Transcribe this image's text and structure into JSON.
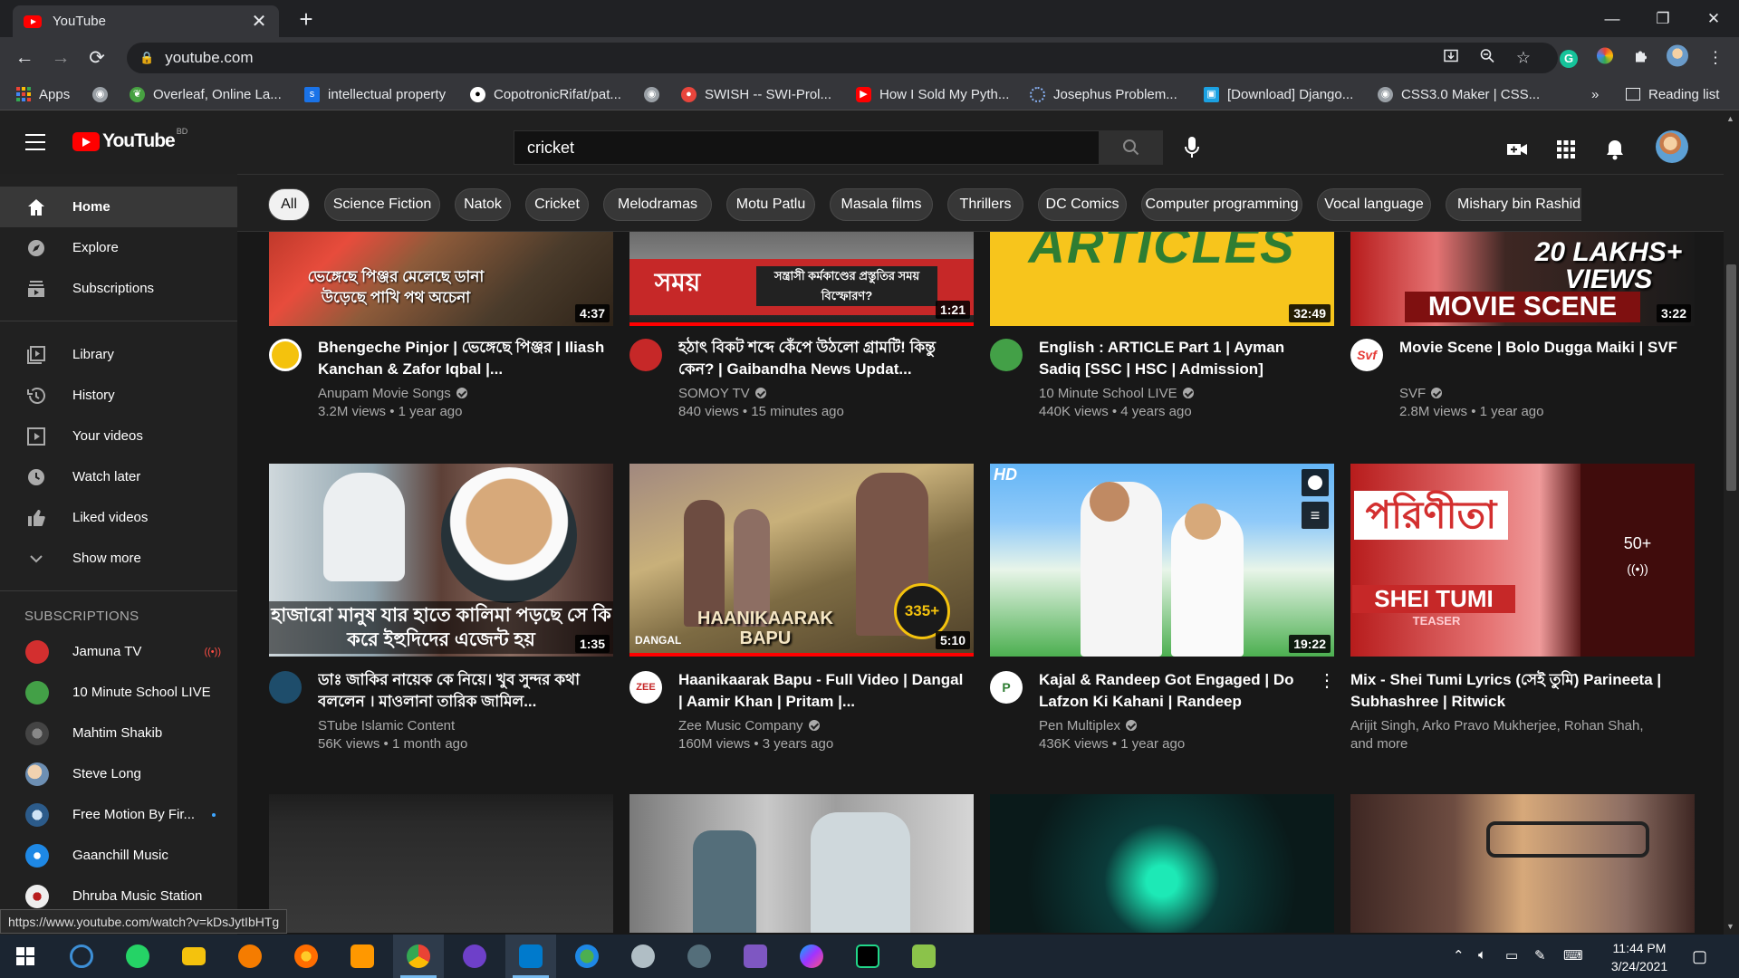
{
  "browser": {
    "tab_title": "YouTube",
    "tab_close": "✕",
    "new_tab": "+",
    "url": "youtube.com",
    "lock": "🔒",
    "min": "—",
    "max": "❐",
    "close": "✕",
    "back": "←",
    "forward": "→",
    "reload": "⟳",
    "more_bookmarks": "»",
    "reading_list": "Reading list"
  },
  "bookmarks": [
    {
      "label": "Apps",
      "icon": "apps-grid-icon",
      "color": "#e94235"
    },
    {
      "label": "",
      "icon": "globe-icon",
      "color": "#9aa0a6"
    },
    {
      "label": "Overleaf, Online La...",
      "icon": "overleaf-icon",
      "color": "#47a141"
    },
    {
      "label": "intellectual property",
      "icon": "s-icon",
      "color": "#1a73e8"
    },
    {
      "label": "CopotronicRifat/pat...",
      "icon": "github-icon",
      "color": "#ffffff"
    },
    {
      "label": "",
      "icon": "globe-icon",
      "color": "#9aa0a6"
    },
    {
      "label": "SWISH -- SWI-Prol...",
      "icon": "swish-icon",
      "color": "#e8453c"
    },
    {
      "label": "How I Sold My Pyth...",
      "icon": "youtube-icon",
      "color": "#ff0000"
    },
    {
      "label": "Josephus Problem...",
      "icon": "loading-icon",
      "color": "#8ab4f8"
    },
    {
      "label": "[Download] Django...",
      "icon": "image-icon",
      "color": "#1ba1e2"
    },
    {
      "label": "CSS3.0 Maker | CSS...",
      "icon": "globe-icon",
      "color": "#9aa0a6"
    }
  ],
  "yt": {
    "logo_text": "YouTube",
    "country": "BD",
    "search_value": "cricket"
  },
  "sidebar": {
    "main": [
      {
        "label": "Home",
        "icon": "home-icon"
      },
      {
        "label": "Explore",
        "icon": "explore-icon"
      },
      {
        "label": "Subscriptions",
        "icon": "subscriptions-icon"
      }
    ],
    "library": [
      {
        "label": "Library",
        "icon": "library-icon"
      },
      {
        "label": "History",
        "icon": "history-icon"
      },
      {
        "label": "Your videos",
        "icon": "your-videos-icon"
      },
      {
        "label": "Watch later",
        "icon": "watch-later-icon"
      },
      {
        "label": "Liked videos",
        "icon": "liked-videos-icon"
      },
      {
        "label": "Show more",
        "icon": "chevron-down-icon"
      }
    ],
    "subscriptions_heading": "SUBSCRIPTIONS",
    "live_badge": "((•))",
    "subscriptions": [
      {
        "label": "Jamuna TV",
        "color": "#d32f2f"
      },
      {
        "label": "10 Minute School LIVE",
        "color": "#43a047"
      },
      {
        "label": "Mahtim Shakib",
        "color": "#555555"
      },
      {
        "label": "Steve Long",
        "color": "#6d8fb3"
      },
      {
        "label": "Free Motion By Fir...",
        "color": "#2c5b8a"
      },
      {
        "label": "Gaanchill Music",
        "color": "#1e88e5"
      },
      {
        "label": "Dhruba Music Station",
        "color": "#eeeeee"
      }
    ]
  },
  "chips": [
    "All",
    "Science Fiction",
    "Natok",
    "Cricket",
    "Melodramas",
    "Motu Patlu",
    "Masala films",
    "Thrillers",
    "DC Comics",
    "Computer programming",
    "Vocal language",
    "Mishary bin Rashid Alaf"
  ],
  "chip_next": "›",
  "videos_row1": [
    {
      "title": "Bhengeche Pinjor | ভেঙ্গেছে পিঞ্জর | Iliash Kanchan & Zafor Iqbal |...",
      "channel": "Anupam Movie Songs",
      "verified": true,
      "meta": "3.2M views • 1 year ago",
      "duration": "4:37",
      "thumb_text": "ভেঙ্গেছে পিঞ্জর মেলেছে ডানা উড়েছে পাখি পথ অচেনা",
      "avatar_color": "#f4c20d"
    },
    {
      "title": "হঠাৎ বিকট শব্দে কেঁপে উঠলো গ্রামটি! কিন্তু কেন? | Gaibandha News Updat...",
      "channel": "SOMOY TV",
      "verified": true,
      "meta": "840 views • 15 minutes ago",
      "duration": "1:21",
      "thumb_text": "সময়",
      "thumb_text2": "সন্ত্রাসী কর্মকাণ্ডের প্রস্তুতির সময় বিস্ফোরণ?",
      "avatar_color": "#c62828"
    },
    {
      "title": "English : ARTICLE Part 1 | Ayman Sadiq [SSC | HSC | Admission]",
      "channel": "10 Minute School LIVE",
      "verified": true,
      "meta": "440K views • 4 years ago",
      "duration": "32:49",
      "thumb_text": "ARTICLES",
      "avatar_color": "#43a047"
    },
    {
      "title": "Movie Scene | Bolo Dugga Maiki | SVF",
      "channel": "SVF",
      "verified": true,
      "meta": "2.8M views • 1 year ago",
      "duration": "3:22",
      "thumb_text": "20 LAKHS+ VIEWS",
      "thumb_text2": "MOVIE SCENE",
      "avatar_color": "#ffffff"
    }
  ],
  "videos_row2": [
    {
      "title": "ডাঃ জাকির নায়েক কে নিয়ে। খুব সুন্দর কথা বললেন । মাওলানা তারিক জামিল...",
      "channel": "STube Islamic Content",
      "verified": false,
      "meta": "56K views • 1 month ago",
      "duration": "1:35",
      "thumb_text": "হাজারো মানুষ যার হাতে কালিমা পড়ছে সে কি করে ইহুদিদের এজেন্ট হয়",
      "avatar_color": "#1e4d6b"
    },
    {
      "title": "Haanikaarak Bapu - Full Video | Dangal | Aamir Khan | Pritam |...",
      "channel": "Zee Music Company",
      "verified": true,
      "meta": "160M views • 3 years ago",
      "duration": "5:10",
      "thumb_text": "HAANIKAARAK BAPU",
      "thumb_text2": "DANGAL",
      "badge": "335+",
      "avatar_color": "#ffffff"
    },
    {
      "title": "Kajal & Randeep Got Engaged | Do Lafzon Ki Kahani | Randeep Hooda,...",
      "channel": "Pen Multiplex",
      "verified": true,
      "meta": "436K views • 1 year ago",
      "duration": "19:22",
      "thumb_text": "HD",
      "avatar_color": "#ffffff"
    },
    {
      "title": "Mix - Shei Tumi Lyrics (সেই তুমি) Parineeta | Subhashree | Ritwick",
      "channel": "Arijit Singh, Arko Pravo Mukherjee, Rohan Shah,",
      "verified": false,
      "meta": "and more",
      "duration": "",
      "thumb_text": "পরিণীতা",
      "thumb_text2": "SHEI TUMI",
      "thumb_text3": "TEASER",
      "mix_count": "50+",
      "mix_icon": "((•))",
      "avatar_color": ""
    }
  ],
  "status_url": "https://www.youtube.com/watch?v=kDsJytIbHTg",
  "clock": {
    "time": "11:44 PM",
    "date": "3/24/2021"
  }
}
